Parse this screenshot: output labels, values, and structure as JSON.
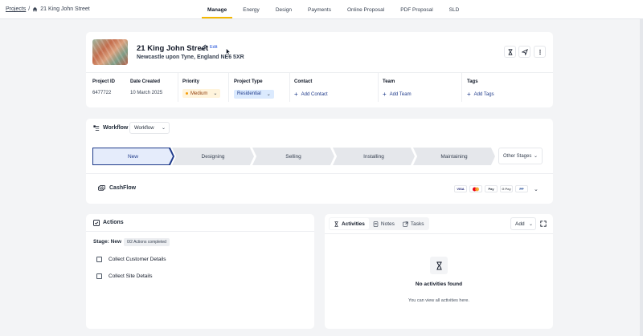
{
  "breadcrumb": {
    "root": "Projects",
    "separator": "/",
    "current": "21 King John Street"
  },
  "nav": {
    "tabs": [
      "Manage",
      "Energy",
      "Design",
      "Payments",
      "Online Proposal",
      "PDF Proposal",
      "SLD"
    ],
    "active": "Manage"
  },
  "project": {
    "title": "21 King John Street",
    "edit_label": "Edit",
    "address": "Newcastle upon Tyne, England NE6 5XR",
    "fields": {
      "id_label": "Project ID",
      "id_value": "6477722",
      "created_label": "Date Created",
      "created_value": "10 March 2025",
      "priority_label": "Priority",
      "priority_value": "Medium",
      "type_label": "Project Type",
      "type_value": "Residential",
      "contact_label": "Contact",
      "contact_action": "Add Contact",
      "team_label": "Team",
      "team_action": "Add Team",
      "tags_label": "Tags",
      "tags_action": "Add Tags"
    }
  },
  "workflow": {
    "title": "Workflow",
    "select_value": "Workflow",
    "stages": [
      "New",
      "Designing",
      "Selling",
      "Installing",
      "Maintaining"
    ],
    "active_stage": "New",
    "other_stages_label": "Other Stages",
    "cashflow_label": "CashFlow",
    "payment_methods": [
      "VISA",
      "MC",
      "Pay",
      "G Pay",
      "PP"
    ]
  },
  "actions": {
    "title": "Actions",
    "stage_label": "Stage: New",
    "progress_badge": "0/2 Actions completed",
    "items": [
      "Collect Customer Details",
      "Collect Site Details"
    ]
  },
  "activity": {
    "tabs": [
      "Activities",
      "Notes",
      "Tasks"
    ],
    "active_tab": "Activities",
    "add_label": "Add",
    "empty_title": "No activities found",
    "empty_subtitle": "You can view all activities here."
  },
  "colors": {
    "accent": "#f5b800",
    "primary": "#1e3a8a",
    "background": "#f3f4f6"
  }
}
